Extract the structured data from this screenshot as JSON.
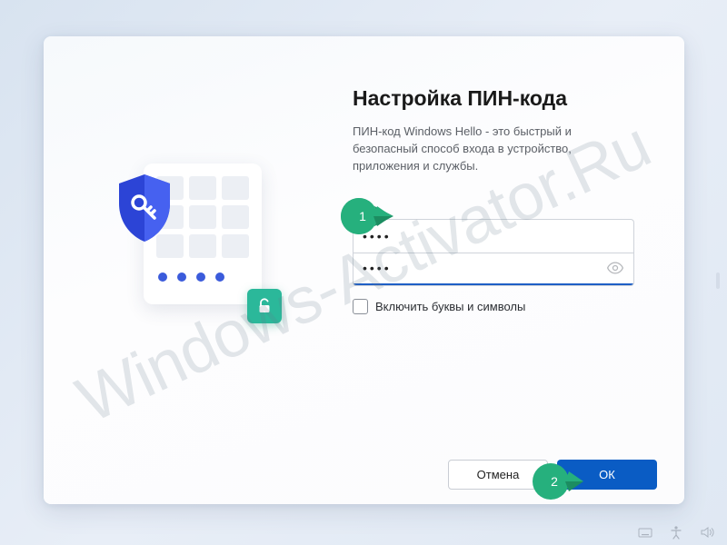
{
  "watermark": "Windows-Activator.Ru",
  "dialog": {
    "title": "Настройка ПИН-кода",
    "subtitle": "ПИН-код Windows Hello - это быстрый и безопасный способ входа в устройство, приложения и службы.",
    "pin_value": "••••",
    "pin_confirm_value": "••••",
    "checkbox_label": "Включить буквы и символы",
    "cancel_label": "Отмена",
    "ok_label": "ОК"
  },
  "callouts": {
    "one": "1",
    "two": "2"
  }
}
